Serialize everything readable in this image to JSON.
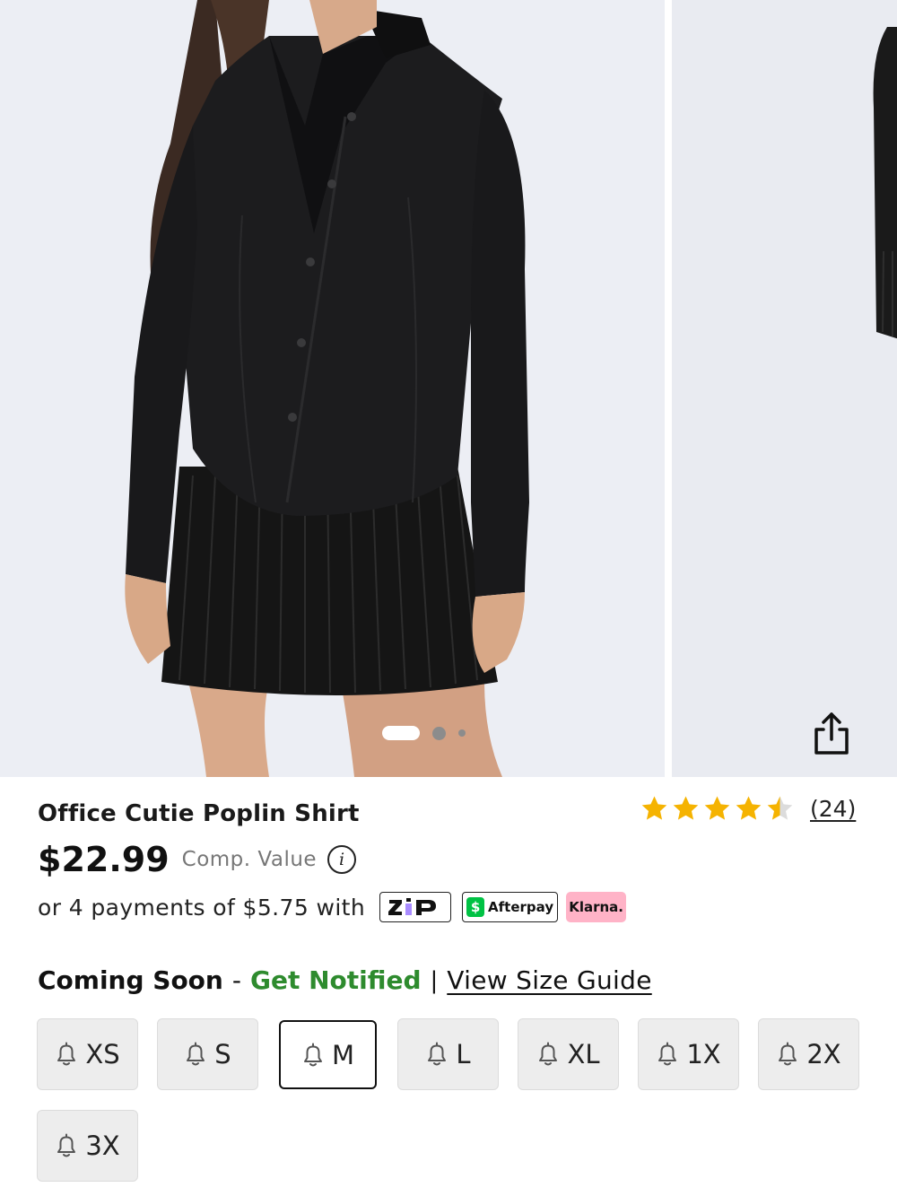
{
  "product": {
    "title": "Office Cutie Poplin Shirt",
    "price": "$22.99",
    "comp_value_label": "Comp. Value",
    "info_glyph": "i",
    "rating": 4.5,
    "review_count": "(24)"
  },
  "gallery": {
    "current_slide": 1,
    "slide_count": 3,
    "share_icon": "share-icon"
  },
  "payments": {
    "text": "or 4 payments of $5.75 with",
    "providers": {
      "zip": "zip",
      "afterpay": "Afterpay",
      "afterpay_mark": "$",
      "klarna": "Klarna."
    }
  },
  "notify": {
    "status": "Coming Soon",
    "dash": "-",
    "action": "Get Notified",
    "separator": "|",
    "size_guide": "View Size Guide"
  },
  "sizes": {
    "selected": "M",
    "options": [
      "XS",
      "S",
      "M",
      "L",
      "XL",
      "1X",
      "2X",
      "3X"
    ]
  },
  "colors": {
    "star": "#f5b301",
    "notify_green": "#2e8b2e",
    "afterpay_green": "#00c244",
    "klarna_pink": "#ffb3c7",
    "zip_purple": "#a98cff"
  }
}
